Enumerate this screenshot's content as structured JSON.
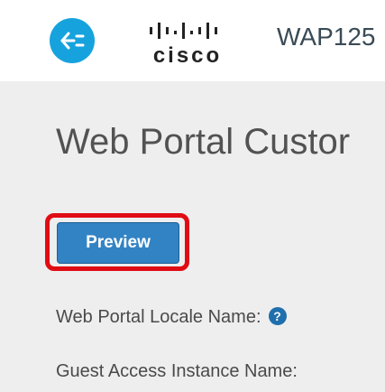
{
  "header": {
    "logo_text": "cisco",
    "device_name": "WAP125",
    "colors": {
      "back_button": "#16a3dd"
    },
    "back_icon": "back-arrow-icon"
  },
  "main": {
    "title": "Web Portal Custor",
    "preview_button": "Preview",
    "fields": [
      {
        "label": "Web Portal Locale Name:",
        "help_icon": "question-circle-icon"
      },
      {
        "label": "Guest Access Instance Name:"
      }
    ],
    "colors": {
      "highlight": "#e00c14",
      "button": "#3283c4"
    }
  }
}
